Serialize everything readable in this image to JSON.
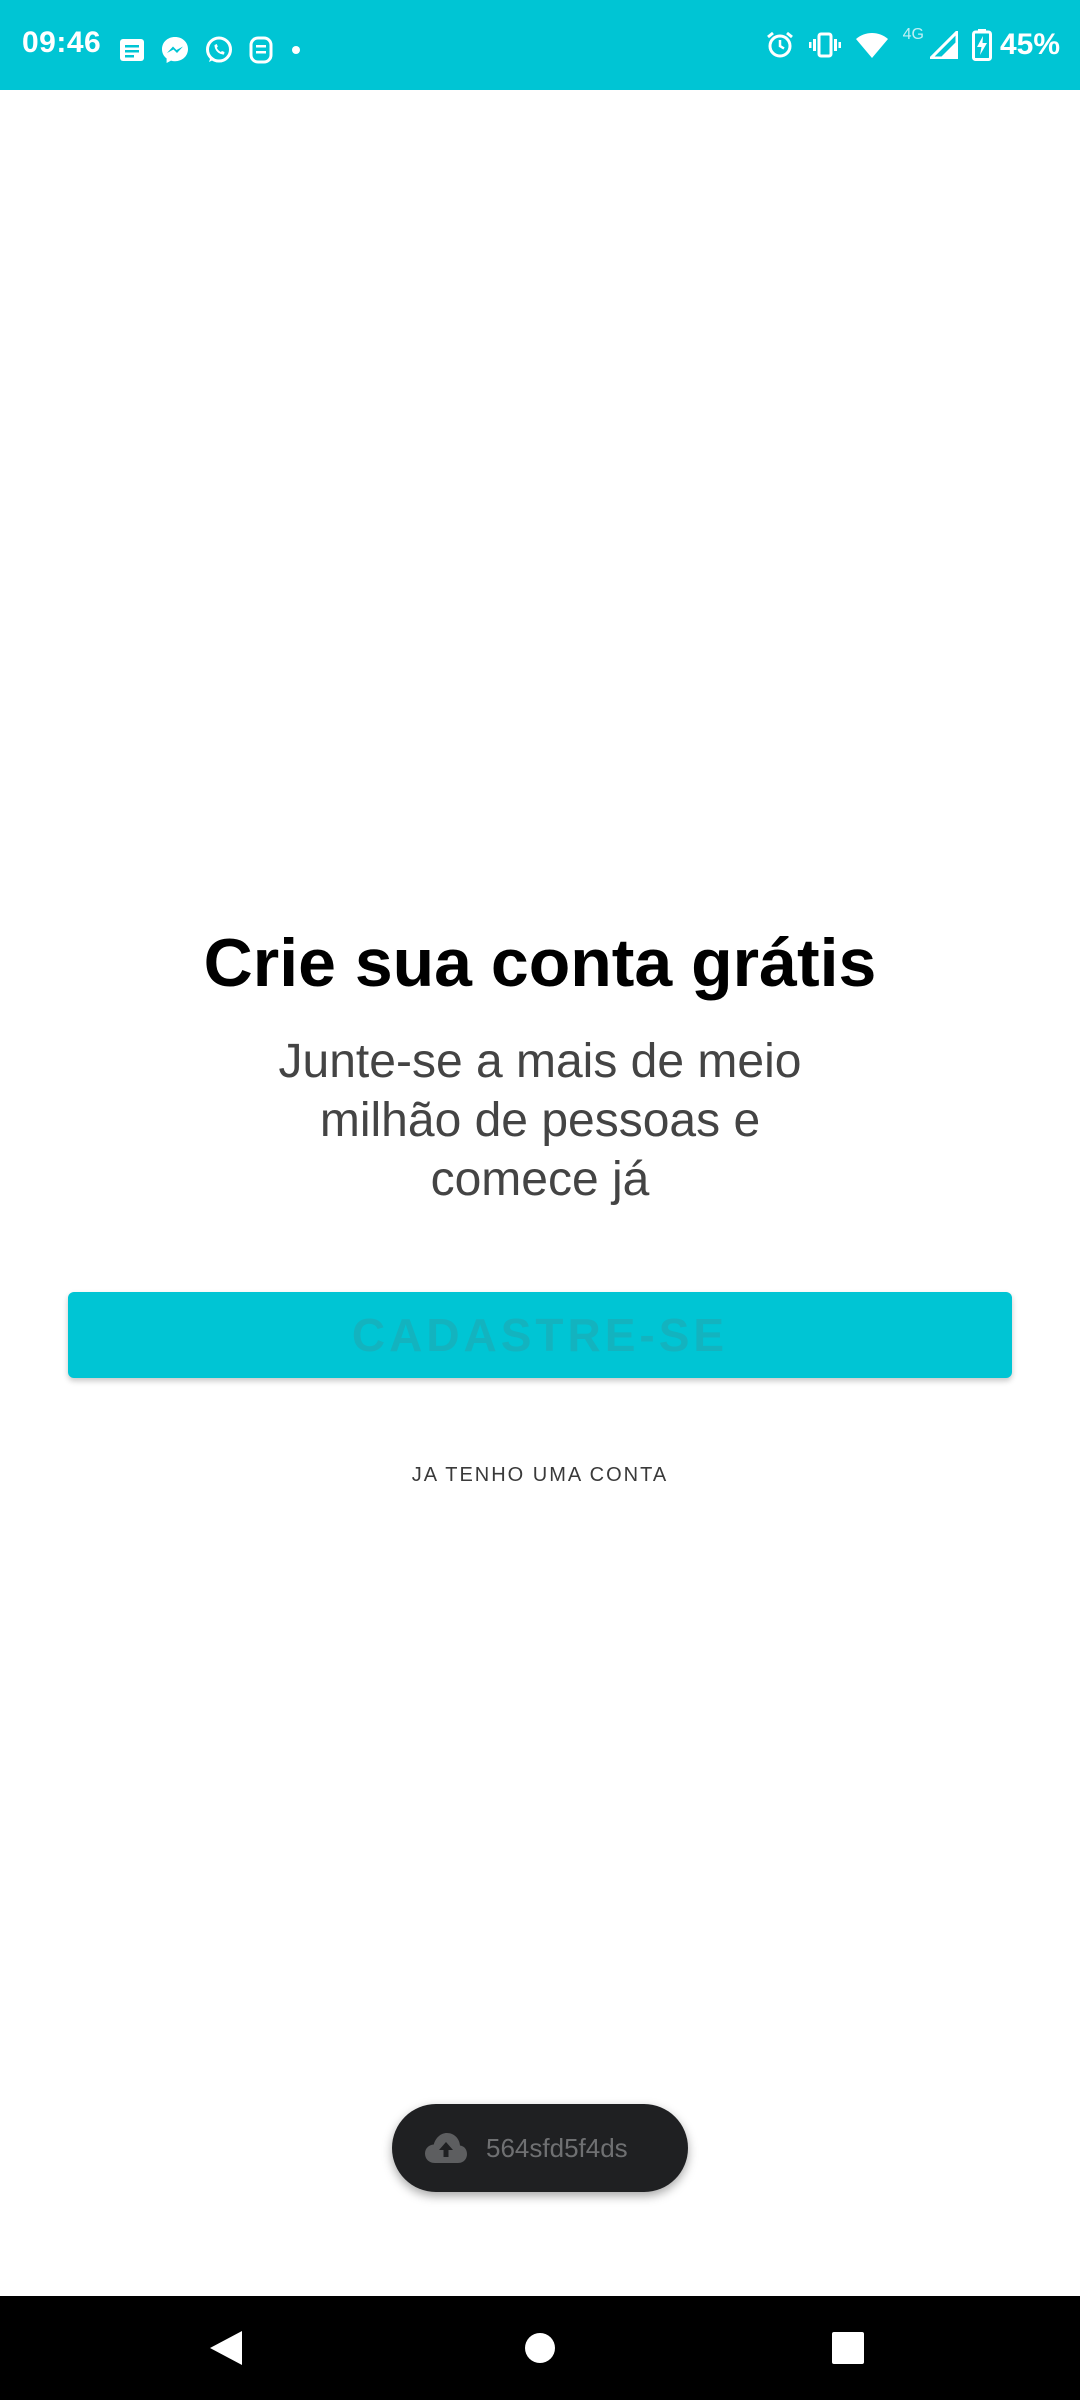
{
  "status_bar": {
    "time": "09:46",
    "network_type": "4G",
    "battery_percent": "45%",
    "background_color": "#00c5d4",
    "left_icons": [
      "messages-icon",
      "messenger-icon",
      "whatsapp-icon",
      "app-notification-icon",
      "dot-icon"
    ],
    "right_icons": [
      "alarm-icon",
      "vibrate-icon",
      "wifi-icon",
      "signal-icon",
      "battery-charging-icon"
    ]
  },
  "main": {
    "headline": "Crie sua conta grátis",
    "subtitle": "Junte-se a mais de meio milhão de pessoas e comece já",
    "signup_button_label": "CADASTRE-SE",
    "login_link_label": "JA TENHO UMA CONTA",
    "accent_color": "#00c5d4"
  },
  "toast": {
    "icon": "cloud-upload-icon",
    "text": "564sfd5f4ds"
  },
  "nav_bar": {
    "buttons": [
      "back-icon",
      "home-icon",
      "recents-icon"
    ]
  }
}
